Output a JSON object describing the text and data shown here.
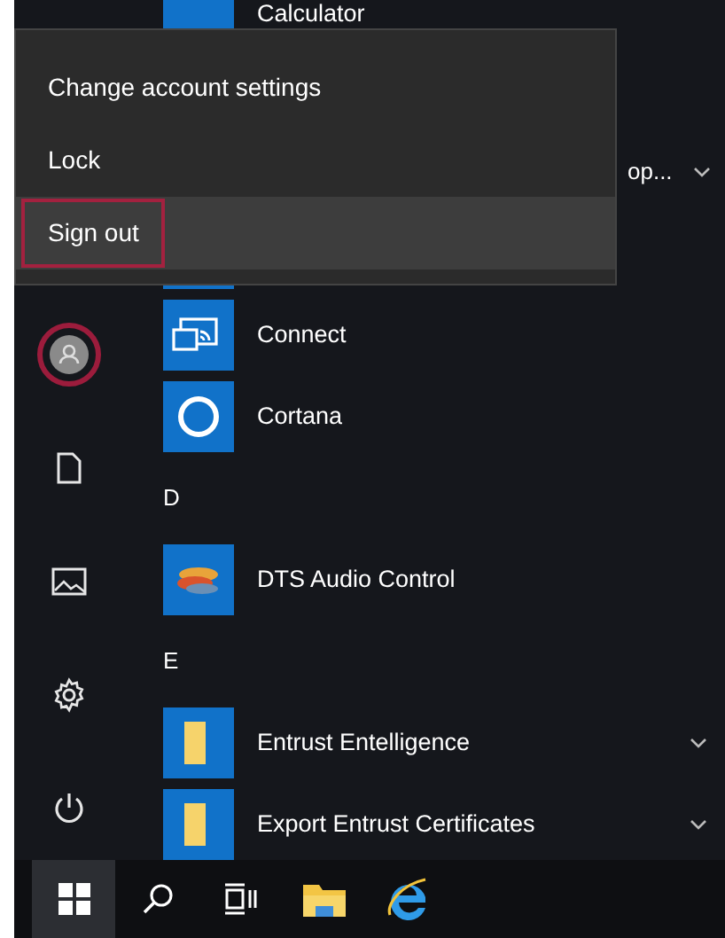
{
  "account_menu": {
    "items": [
      {
        "label": "Change account settings",
        "selected": false,
        "outlined": false
      },
      {
        "label": "Lock",
        "selected": false,
        "outlined": false
      },
      {
        "label": "Sign out",
        "selected": true,
        "outlined": true
      }
    ]
  },
  "rail": [
    {
      "kind": "avatar",
      "outlined": true
    },
    {
      "kind": "documents"
    },
    {
      "kind": "pictures"
    },
    {
      "kind": "settings"
    },
    {
      "kind": "power"
    }
  ],
  "app_list": [
    {
      "kind": "app",
      "label": "Calculator"
    },
    {
      "kind": "blank"
    },
    {
      "kind": "covered",
      "label": "op...",
      "expandable": true
    },
    {
      "kind": "app"
    },
    {
      "kind": "app",
      "label": "Connect"
    },
    {
      "kind": "app",
      "label": "Cortana"
    },
    {
      "kind": "header",
      "label": "D"
    },
    {
      "kind": "app",
      "label": "DTS Audio Control"
    },
    {
      "kind": "header",
      "label": "E"
    },
    {
      "kind": "app",
      "label": "Entrust Entelligence",
      "expandable": true
    },
    {
      "kind": "app",
      "label": "Export Entrust Certificates",
      "expandable": true
    }
  ],
  "taskbar": [
    {
      "kind": "start",
      "selected": true
    },
    {
      "kind": "search",
      "selected": false
    },
    {
      "kind": "taskview",
      "selected": false
    },
    {
      "kind": "explorer",
      "selected": false
    },
    {
      "kind": "browser",
      "selected": false
    }
  ]
}
